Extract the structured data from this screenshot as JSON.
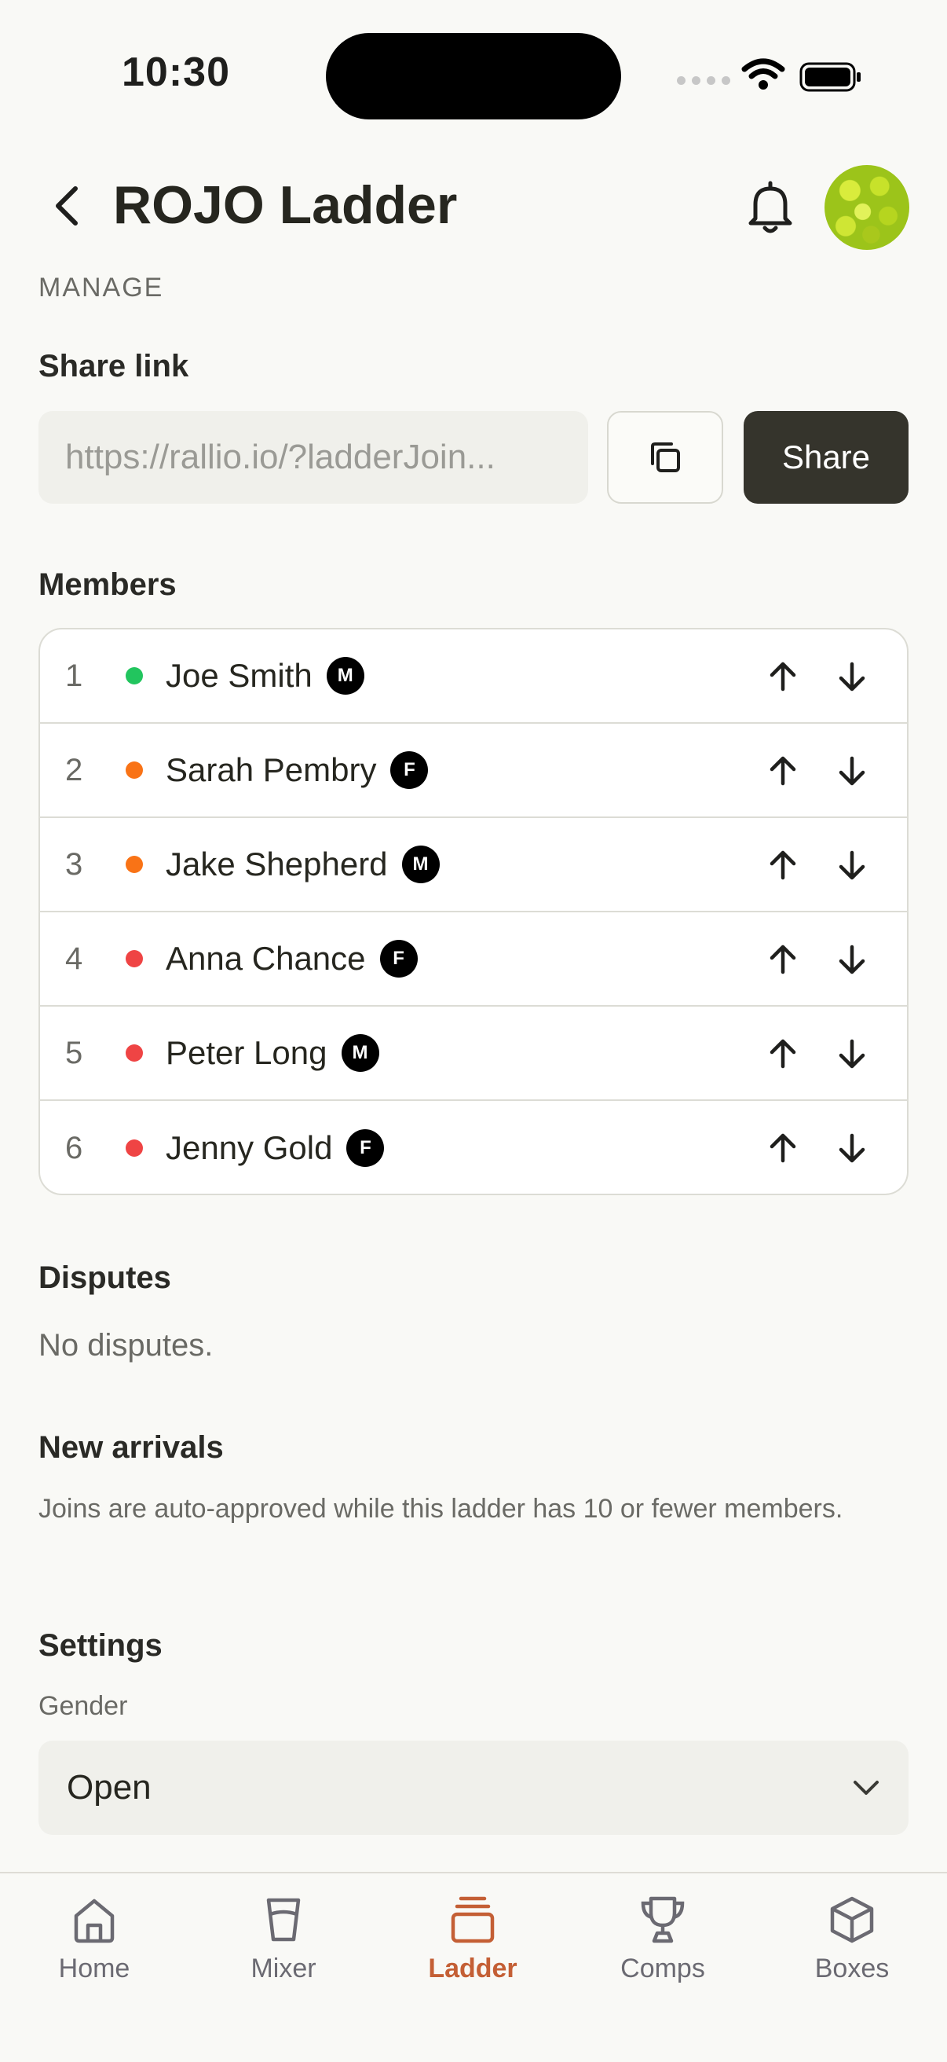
{
  "status_bar": {
    "time": "10:30"
  },
  "header": {
    "title": "ROJO Ladder"
  },
  "manage": {
    "eyebrow": "MANAGE",
    "share_link": {
      "label": "Share link",
      "url": "https://rallio.io/?ladderJoin...",
      "share_label": "Share"
    }
  },
  "members": {
    "label": "Members",
    "rows": [
      {
        "rank": "1",
        "name": "Joe Smith",
        "gender": "M",
        "status_color": "#22c55e"
      },
      {
        "rank": "2",
        "name": "Sarah Pembry",
        "gender": "F",
        "status_color": "#f97316"
      },
      {
        "rank": "3",
        "name": "Jake Shepherd",
        "gender": "M",
        "status_color": "#f97316"
      },
      {
        "rank": "4",
        "name": "Anna Chance",
        "gender": "F",
        "status_color": "#ef4444"
      },
      {
        "rank": "5",
        "name": "Peter Long",
        "gender": "M",
        "status_color": "#ef4444"
      },
      {
        "rank": "6",
        "name": "Jenny Gold",
        "gender": "F",
        "status_color": "#ef4444"
      }
    ]
  },
  "disputes": {
    "label": "Disputes",
    "text": "No disputes."
  },
  "new_arrivals": {
    "label": "New arrivals",
    "text": "Joins are auto-approved while this ladder has 10 or fewer members."
  },
  "settings": {
    "label": "Settings",
    "gender_label": "Gender",
    "gender_value": "Open"
  },
  "nav": {
    "items": [
      {
        "label": "Home",
        "icon": "home-icon"
      },
      {
        "label": "Mixer",
        "icon": "cup-icon"
      },
      {
        "label": "Ladder",
        "icon": "stack-icon",
        "active": true
      },
      {
        "label": "Comps",
        "icon": "trophy-icon"
      },
      {
        "label": "Boxes",
        "icon": "box-icon"
      }
    ]
  },
  "colors": {
    "accent": "#c45f35",
    "primary_button": "#35342c"
  }
}
